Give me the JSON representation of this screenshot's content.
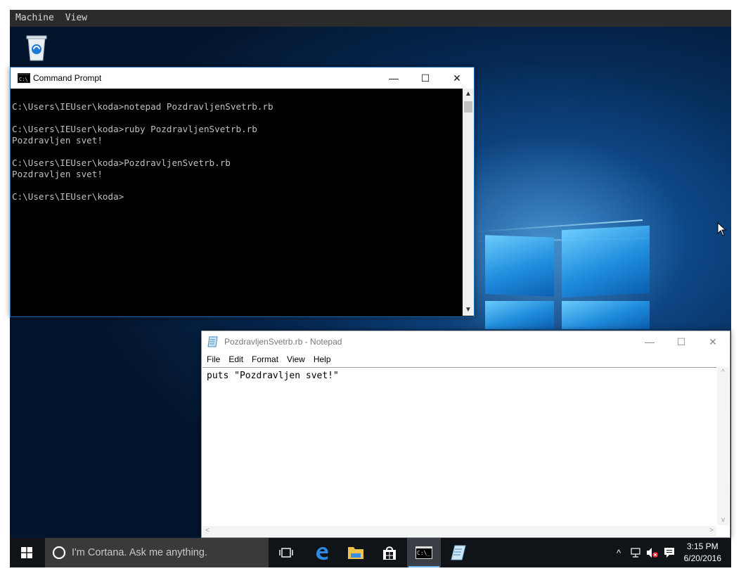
{
  "vm_menu": {
    "machine": "Machine",
    "view": "View"
  },
  "command_prompt": {
    "title": "Command Prompt",
    "lines": [
      "C:\\Users\\IEUser\\koda>notepad PozdravljenSvetrb.rb",
      "",
      "C:\\Users\\IEUser\\koda>ruby PozdravljenSvetrb.rb",
      "Pozdravljen svet!",
      "",
      "C:\\Users\\IEUser\\koda>PozdravljenSvetrb.rb",
      "Pozdravljen svet!",
      "",
      "C:\\Users\\IEUser\\koda>"
    ]
  },
  "notepad": {
    "title": "PozdravljenSvetrb.rb - Notepad",
    "menu": [
      "File",
      "Edit",
      "Format",
      "View",
      "Help"
    ],
    "content": "puts \"Pozdravljen svet!\""
  },
  "window_controls": {
    "minimize": "—",
    "maximize": "☐",
    "close": "✕"
  },
  "taskbar": {
    "cortana_placeholder": "I'm Cortana. Ask me anything.",
    "time": "3:15 PM",
    "date": "6/20/2016",
    "icons": [
      "windows-start-icon",
      "task-view-icon",
      "edge-icon",
      "file-explorer-icon",
      "store-icon",
      "command-prompt-icon",
      "notepad-icon"
    ]
  },
  "desktop": {
    "icons": [
      "recycle-bin-icon"
    ]
  },
  "colors": {
    "taskbar": "#101318",
    "cmd_bg": "#000000",
    "cmd_text": "#c0c0c0",
    "accent": "#1c6fb4"
  }
}
